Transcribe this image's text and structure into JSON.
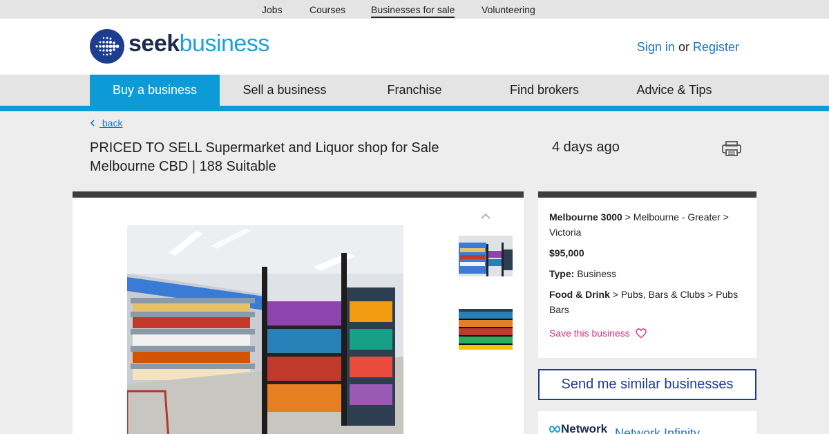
{
  "topnav": {
    "items": [
      {
        "label": "Jobs"
      },
      {
        "label": "Courses"
      },
      {
        "label": "Businesses for sale"
      },
      {
        "label": "Volunteering"
      }
    ]
  },
  "header": {
    "logo_word1": "seek",
    "logo_word2": "business",
    "sign_in": "Sign in",
    "or": "or",
    "register": "Register"
  },
  "mainnav": {
    "items": [
      {
        "label": "Buy a business"
      },
      {
        "label": "Sell a business"
      },
      {
        "label": "Franchise"
      },
      {
        "label": "Find brokers"
      },
      {
        "label": "Advice & Tips"
      }
    ]
  },
  "listing": {
    "back_label": "back",
    "title": "PRICED TO SELL Supermarket and Liquor shop for Sale Melbourne CBD | 188 Suitable",
    "posted": "4 days ago",
    "location_main": "Melbourne 3000",
    "location_rest": " > Melbourne - Greater > Victoria",
    "price": "$95,000",
    "type_label": "Type:",
    "type_value": " Business",
    "category_main": "Food & Drink",
    "category_rest": " > Pubs, Bars & Clubs > Pubs Bars",
    "save_label": "Save this business",
    "similar_label": "Send me similar businesses",
    "broker_logo": "Network",
    "broker_name": "Network Infinity"
  },
  "icons": {
    "print": "printer-icon",
    "save": "heart-icon",
    "back": "chevron-left-icon",
    "thumb_up": "chevron-up-icon"
  },
  "colors": {
    "brand_blue": "#0d9bd7",
    "navy": "#1d3d8f",
    "link": "#1a73c9",
    "save_pink": "#d4317f"
  }
}
